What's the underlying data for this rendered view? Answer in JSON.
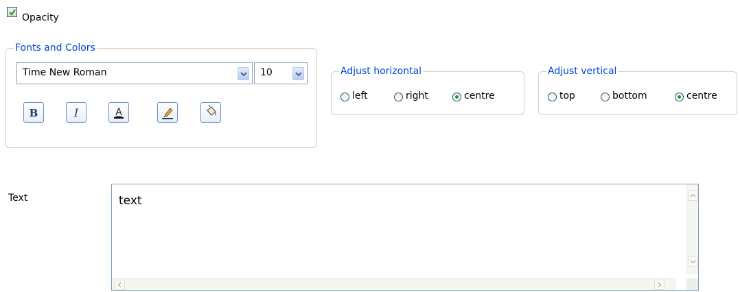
{
  "opacity": {
    "label": "Opacity",
    "checked": true
  },
  "fonts_colors": {
    "title": "Fonts and Colors",
    "font_name": "Time New Roman",
    "font_size": "10",
    "buttons": [
      "bold",
      "italic",
      "font-color",
      "highlight-color",
      "fill-color"
    ]
  },
  "adjust_horizontal": {
    "title": "Adjust horizontal",
    "options": [
      "left",
      "right",
      "centre"
    ],
    "selected": "centre"
  },
  "adjust_vertical": {
    "title": "Adjust vertical",
    "options": [
      "top",
      "bottom",
      "centre"
    ],
    "selected": "centre"
  },
  "text": {
    "label": "Text",
    "value": "text"
  },
  "colors": {
    "group_title": "#0046d5",
    "radio_selected": "#21a121",
    "border": "#7f9db9"
  }
}
